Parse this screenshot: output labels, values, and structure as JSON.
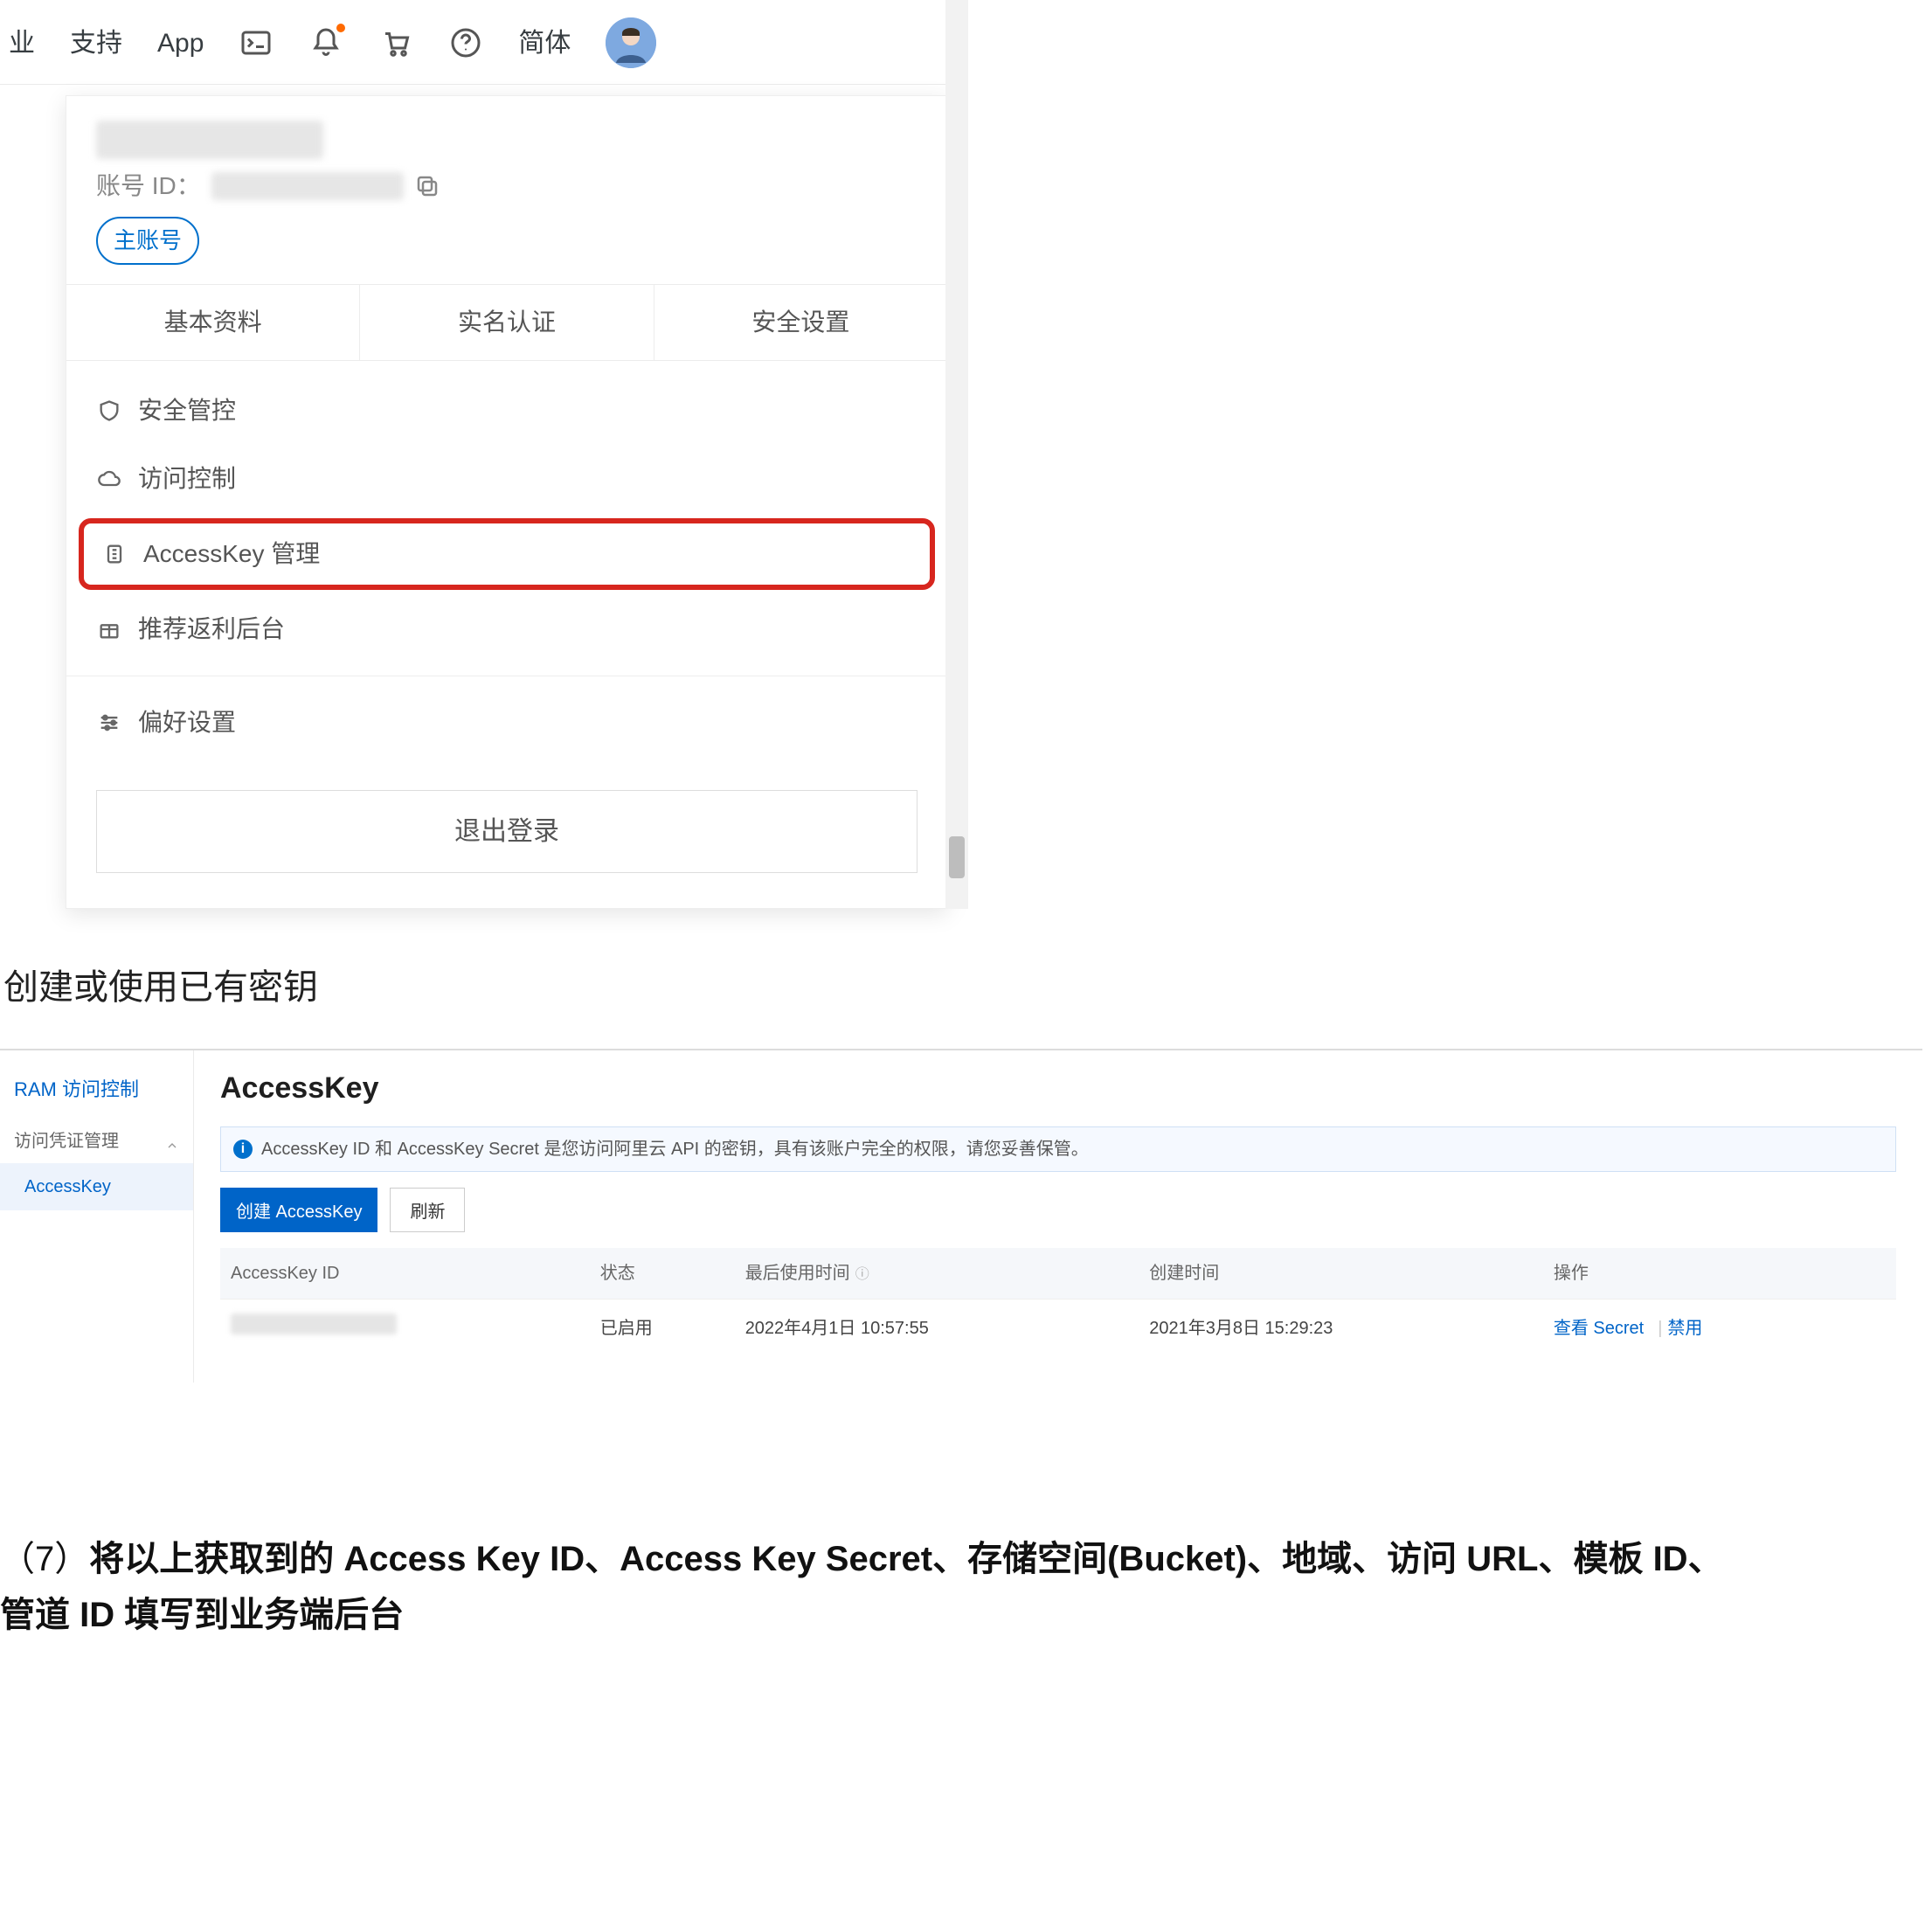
{
  "topnav": {
    "items": [
      "业",
      "支持",
      "App"
    ],
    "lang": "简体"
  },
  "dropdown": {
    "account_id_label": "账号 ID：",
    "main_account_badge": "主账号",
    "tabs": [
      "基本资料",
      "实名认证",
      "安全设置"
    ],
    "menu": {
      "security_control": "安全管控",
      "access_control": "访问控制",
      "access_key": "AccessKey 管理",
      "rebate": "推荐返利后台",
      "preferences": "偏好设置"
    },
    "logout": "退出登录"
  },
  "section_heading": "创建或使用已有密钥",
  "ak_page": {
    "sidebar": {
      "parent": "RAM 访问控制",
      "group": "访问凭证管理",
      "child": "AccessKey"
    },
    "title": "AccessKey",
    "info": "AccessKey ID 和 AccessKey Secret 是您访问阿里云 API 的密钥，具有该账户完全的权限，请您妥善保管。",
    "buttons": {
      "create": "创建 AccessKey",
      "refresh": "刷新"
    },
    "columns": {
      "id": "AccessKey ID",
      "status": "状态",
      "last_used": "最后使用时间",
      "created": "创建时间",
      "ops": "操作"
    },
    "row": {
      "status": "已启用",
      "last_used": "2022年4月1日 10:57:55",
      "created": "2021年3月8日 15:29:23",
      "ops": {
        "view": "查看 Secret",
        "disable": "禁用"
      }
    }
  },
  "instruction": {
    "num": "（7）",
    "bold_line": "将以上获取到的 Access Key ID、Access Key Secret、存储空间(Bucket)、地域、访问 URL、模板 ID、",
    "bold_line2": "管道 ID 填写到业务端后台"
  }
}
